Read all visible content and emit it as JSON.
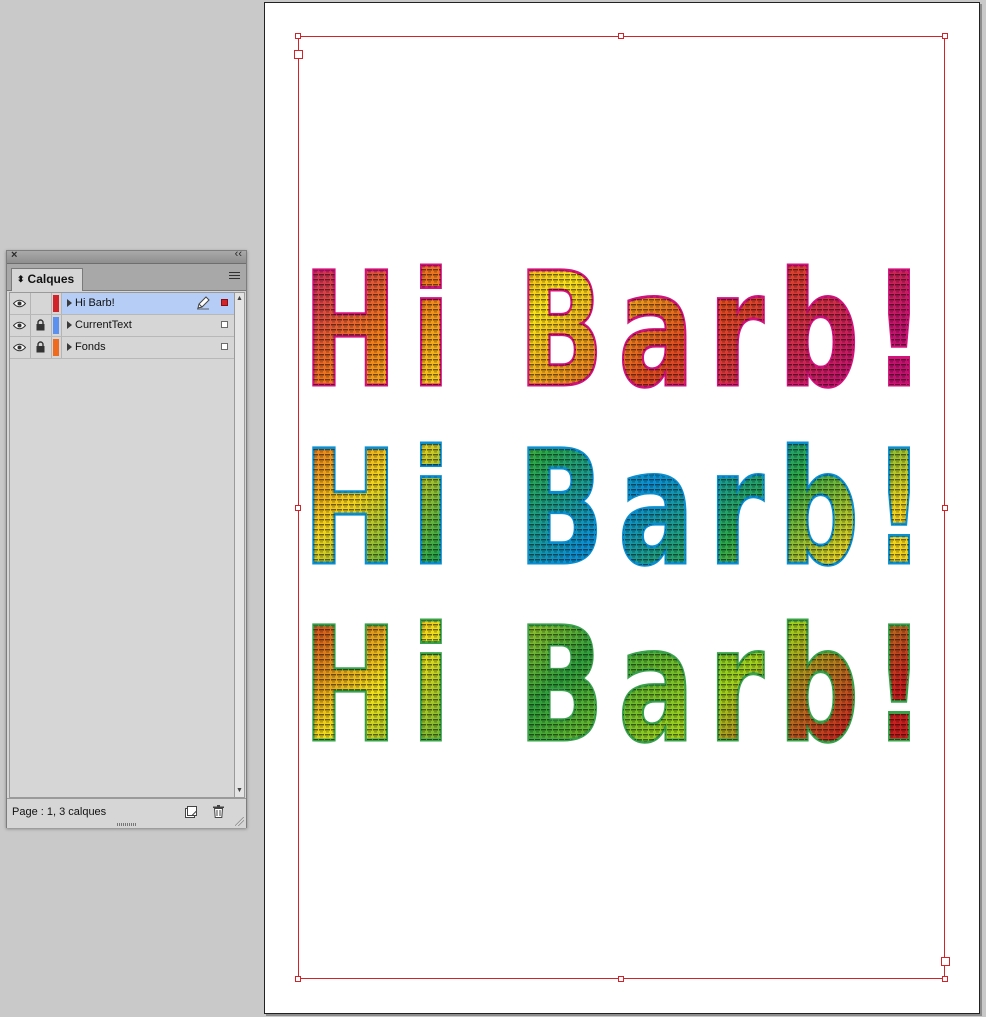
{
  "panel": {
    "title": "Calques",
    "status": "Page : 1, 3 calques",
    "layers": [
      {
        "name": "Hi Barb!",
        "color": "#d2232a",
        "locked": false,
        "selected": true,
        "editing": true
      },
      {
        "name": "CurrentText",
        "color": "#5b8ff0",
        "locked": true,
        "selected": false,
        "editing": false
      },
      {
        "name": "Fonds",
        "color": "#f06a1e",
        "locked": true,
        "selected": false,
        "editing": false
      }
    ]
  },
  "artwork": {
    "lines": [
      {
        "text": "Hi Barb!",
        "stroke": "#d4137a",
        "gradient": "pink-yellow"
      },
      {
        "text": "Hi Barb!",
        "stroke": "#0a8fd0",
        "gradient": "rainbow"
      },
      {
        "text": "Hi Barb!",
        "stroke": "#3aa34a",
        "gradient": "green-red"
      }
    ]
  }
}
